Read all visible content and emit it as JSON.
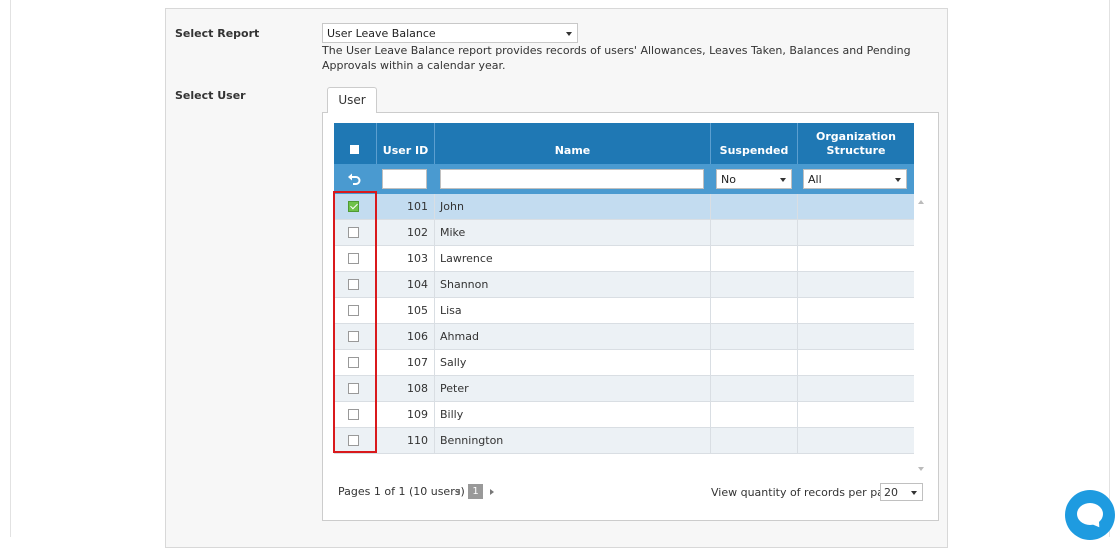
{
  "form": {
    "select_report_label": "Select Report",
    "report_value": "User Leave Balance",
    "report_description": "The User Leave Balance report provides records of users' Allowances, Leaves Taken, Balances and Pending Approvals within a calendar year.",
    "select_user_label": "Select User"
  },
  "tabs": [
    {
      "label": "User",
      "active": true
    }
  ],
  "grid": {
    "columns": {
      "user_id": "User ID",
      "name": "Name",
      "suspended": "Suspended",
      "org_structure": "Organization Structure"
    },
    "filters": {
      "user_id": "",
      "name": "",
      "suspended": "No",
      "org_structure": "All"
    },
    "rows": [
      {
        "id": "101",
        "name": "John",
        "suspended": "",
        "org": "",
        "checked": true
      },
      {
        "id": "102",
        "name": "Mike",
        "suspended": "",
        "org": "",
        "checked": false
      },
      {
        "id": "103",
        "name": "Lawrence",
        "suspended": "",
        "org": "",
        "checked": false
      },
      {
        "id": "104",
        "name": "Shannon",
        "suspended": "",
        "org": "",
        "checked": false
      },
      {
        "id": "105",
        "name": "Lisa",
        "suspended": "",
        "org": "",
        "checked": false
      },
      {
        "id": "106",
        "name": "Ahmad",
        "suspended": "",
        "org": "",
        "checked": false
      },
      {
        "id": "107",
        "name": "Sally",
        "suspended": "",
        "org": "",
        "checked": false
      },
      {
        "id": "108",
        "name": "Peter",
        "suspended": "",
        "org": "",
        "checked": false
      },
      {
        "id": "109",
        "name": "Billy",
        "suspended": "",
        "org": "",
        "checked": false
      },
      {
        "id": "110",
        "name": "Bennington",
        "suspended": "",
        "org": "",
        "checked": false
      }
    ]
  },
  "pager": {
    "summary": "Pages 1 of 1 (10 users)",
    "current_page": "1",
    "per_page_label": "View quantity of records per page",
    "per_page_value": "20"
  },
  "colors": {
    "header_blue": "#1f78b4",
    "filter_blue": "#4a9ad0",
    "selected_row": "#c3dcf0",
    "highlight_red": "#d9191c",
    "chat_blue": "#1e9be0"
  },
  "icons": [
    "undo-icon",
    "chat-icon",
    "chevron-down-icon"
  ]
}
